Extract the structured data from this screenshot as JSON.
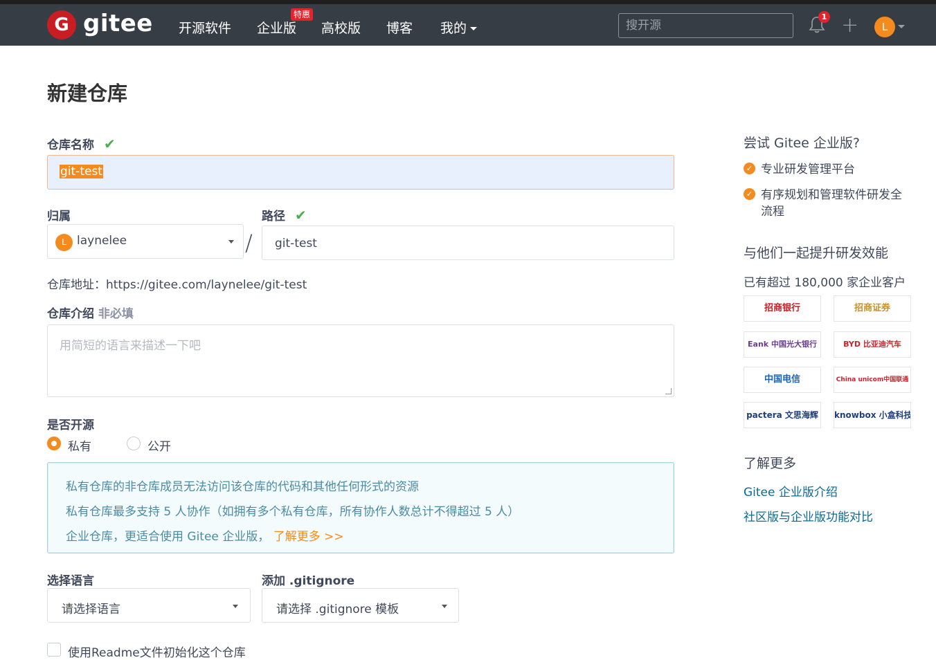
{
  "navbar": {
    "logo_text": "gitee",
    "logo_letter": "G",
    "items": [
      "开源软件",
      "企业版",
      "高校版",
      "博客",
      "我的"
    ],
    "badge": "特惠",
    "search_placeholder": "搜开源",
    "notif_count": "1",
    "plus": "+",
    "avatar_letter": "L",
    "icons": [
      "bell-icon",
      "plus-icon",
      "chevron-down-icon"
    ]
  },
  "form": {
    "title": "新建仓库",
    "name_label": "仓库名称",
    "name_value": "git-test",
    "owner_label": "归属",
    "owner_avatar": "L",
    "owner_value": "laynelee",
    "slash": "/",
    "path_label": "路径",
    "path_value": "git-test",
    "address_prefix": "仓库地址：",
    "address_value": "https://gitee.com/laynelee/git-test",
    "desc_label": "仓库介绍",
    "desc_optional": "非必填",
    "desc_placeholder": "用简短的语言来描述一下吧",
    "open_label": "是否开源",
    "private_label": "私有",
    "public_label": "公开",
    "info_line1": "私有仓库的非仓库成员无法访问该仓库的代码和其他任何形式的资源",
    "info_line2": "私有仓库最多支持 5 人协作（如拥有多个私有仓库，所有协作人数总计不得超过 5 人）",
    "info_line3": "企业仓库，更适合使用 Gitee 企业版，",
    "info_link": "了解更多 >>",
    "lang_label": "选择语言",
    "lang_placeholder": "请选择语言",
    "gitignore_label": "添加 .gitignore",
    "gitignore_placeholder": "请选择 .gitignore 模板",
    "readme_label": "使用Readme文件初始化这个仓库"
  },
  "sidebar": {
    "try_title": "尝试 Gitee 企业版?",
    "features": [
      "专业研发管理平台",
      "有序规划和管理软件研发全流程"
    ],
    "together_title": "与他们一起提升研发效能",
    "customers": "已有超过 180,000 家企业客户",
    "logos": [
      "招商银行",
      "招商证券",
      "Eank 中国光大银行",
      "BYD 比亚迪汽车",
      "中国电信",
      "China unicom中国联通",
      "pactera 文思海辉",
      "knowbox 小盒科技"
    ],
    "learn_title": "了解更多",
    "links": [
      "Gitee 企业版介绍",
      "社区版与企业版功能对比"
    ]
  },
  "colors": {
    "navbar_bg": "#373d45",
    "accent": "#f48b1f",
    "brand_red": "#c71d23",
    "success": "#4cae4c",
    "link": "#0a6a97"
  }
}
